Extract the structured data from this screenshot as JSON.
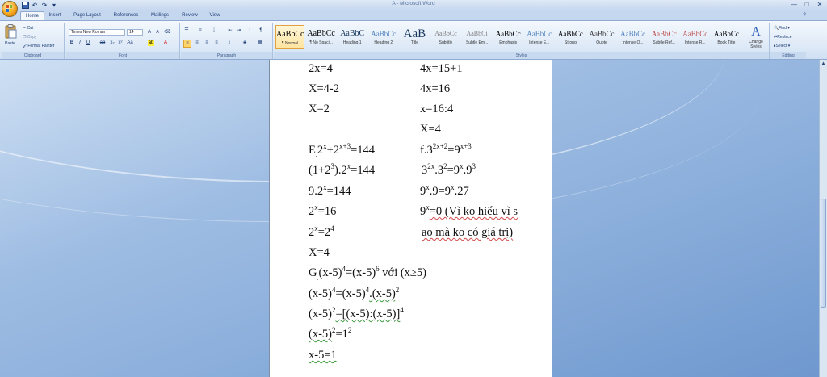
{
  "window": {
    "title": "A - Microsoft Word",
    "controls": [
      "—",
      "□",
      "✕"
    ]
  },
  "quick_access": [
    "save-icon",
    "undo-icon",
    "redo-icon",
    "customize-icon"
  ],
  "tabs": [
    "Home",
    "Insert",
    "Page Layout",
    "References",
    "Mailings",
    "Review",
    "View"
  ],
  "ribbon": {
    "clipboard": {
      "paste": "Paste",
      "cut": "Cut",
      "copy": "Copy",
      "format_painter": "Format Painter",
      "label": "Clipboard"
    },
    "font": {
      "name": "Times New Roman",
      "size": "14",
      "label": "Font"
    },
    "paragraph": {
      "label": "Paragraph"
    },
    "styles": {
      "label": "Styles",
      "items": [
        {
          "sample": "AaBbCc",
          "name": "¶ Normal"
        },
        {
          "sample": "AaBbCc",
          "name": "¶ No Spaci..."
        },
        {
          "sample": "AaBbC",
          "name": "Heading 1"
        },
        {
          "sample": "AaBbCc",
          "name": "Heading 2"
        },
        {
          "sample": "AaB",
          "name": "Title"
        },
        {
          "sample": "AaBbCc",
          "name": "Subtitle"
        },
        {
          "sample": "AaBbCi",
          "name": "Subtle Em..."
        },
        {
          "sample": "AaBbCc",
          "name": "Emphasis"
        },
        {
          "sample": "AaBbCc",
          "name": "Intense E..."
        },
        {
          "sample": "AaBbCc",
          "name": "Strong"
        },
        {
          "sample": "AaBbCc",
          "name": "Quote"
        },
        {
          "sample": "AaBbCc",
          "name": "Intense Q..."
        },
        {
          "sample": "AaBbCc",
          "name": "Subtle Ref..."
        },
        {
          "sample": "AaBbCc",
          "name": "Intense R..."
        },
        {
          "sample": "AaBbCc",
          "name": "Book Title"
        }
      ],
      "change_styles": "Change Styles"
    },
    "editing": {
      "find": "Find",
      "replace": "Replace",
      "select": "Select",
      "label": "Editing"
    }
  },
  "document": {
    "l1_left": "2x=4",
    "l1_right": "4x=15+1",
    "l2_left": "X=4-2",
    "l2_right": "4x=16",
    "l3_left": "X=2",
    "l3_right": "x=16:4",
    "l4_right": "X=4",
    "e_label": "E",
    "e_sub": ",",
    "e_base1": "2",
    "e_exp1": "x",
    "e_plus": "+2",
    "e_exp2": "x+3",
    "e_rest": "=144",
    "f_label": "f",
    "f_mid": ".3",
    "f_exp1": "2x+2",
    "f_eq": "=9",
    "f_exp2": "x+3",
    "l6_left_a": "(1+2",
    "l6_left_exp": "3",
    "l6_left_b": ").2",
    "l6_left_exp2": "x",
    "l6_left_c": "=144",
    "l6_right_a": "3",
    "l6_right_exp1": "2x",
    "l6_right_b": ".3",
    "l6_right_exp2": "2",
    "l6_right_c": "=9",
    "l6_right_exp3": "x",
    "l6_right_d": ".9",
    "l6_right_exp4": "3",
    "l7_left_a": "9.2",
    "l7_left_exp": "x",
    "l7_left_b": "=144",
    "l7_right_a": "9",
    "l7_right_exp1": "x",
    "l7_right_b": ".9=9",
    "l7_right_exp2": "x",
    "l7_right_c": ".27",
    "l8_left_a": "2",
    "l8_left_exp": "x",
    "l8_left_b": "=16",
    "l8_right_a": "9",
    "l8_right_exp": "x",
    "l8_right_b": "=0 (Vì ko hiểu vì s",
    "l9_left_a": "2",
    "l9_left_exp1": "x",
    "l9_left_b": "=2",
    "l9_left_exp2": "4",
    "l9_right": "ao mà ko có giá trị)",
    "l10": "X=4",
    "g_label": "G",
    "g_sub": ",",
    "g_a": "(x-5)",
    "g_exp1": "4",
    "g_b": "=(x-5)",
    "g_exp2": "6",
    "g_c": " với (x≥5)",
    "l12_a": "(x-5)",
    "l12_exp1": "4",
    "l12_b": "=(x-5)",
    "l12_exp2": "4",
    "l12_c": ".(x-5)",
    "l12_exp3": "2",
    "l13_a": "(x-5)",
    "l13_exp1": "2",
    "l13_b": "=[(x-5):(x-5)]",
    "l13_exp2": "4",
    "l14_a": "(x-5)",
    "l14_exp1": "2",
    "l14_b": "=1",
    "l14_exp2": "2",
    "l15": "x-5=1"
  },
  "colors": {
    "accent": "#2b579a",
    "workspace": "#8db0dc",
    "spell_error": "#d24a4a",
    "grammar_error": "#3a9a3a"
  }
}
